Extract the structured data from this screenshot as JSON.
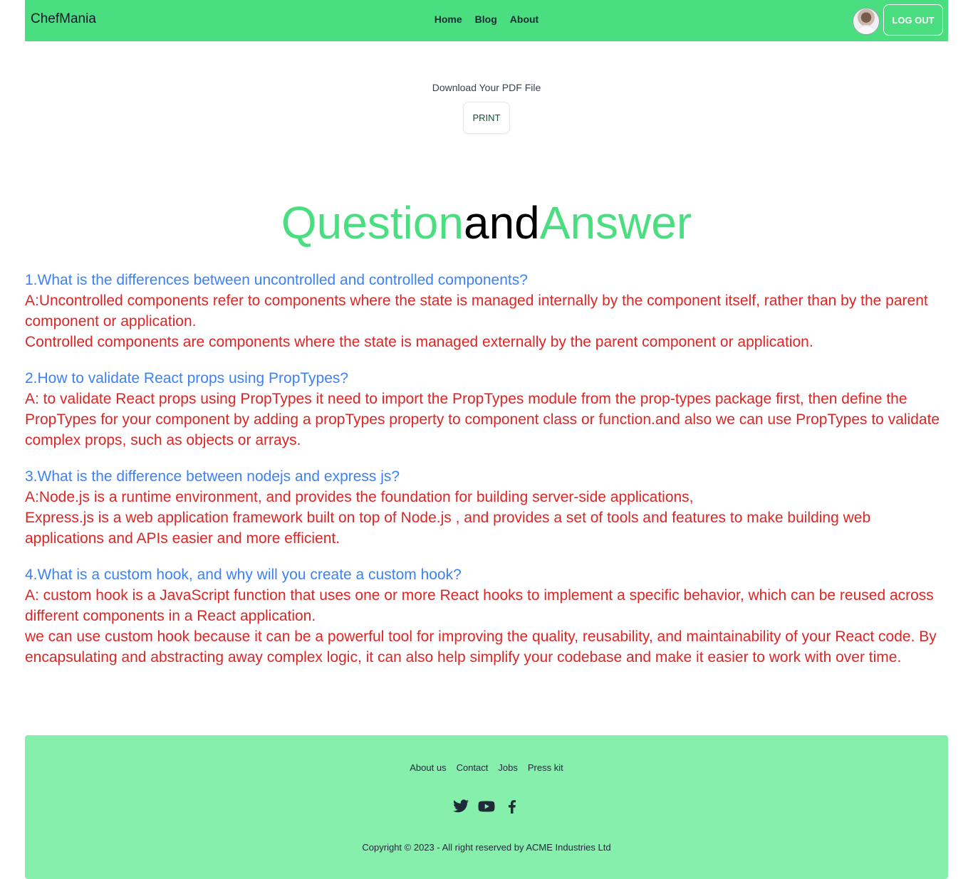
{
  "navbar": {
    "brand": "ChefMania",
    "links": [
      "Home",
      "Blog",
      "About"
    ],
    "logout_label": "LOG OUT",
    "avatar": "user-avatar"
  },
  "download": {
    "label": "Download Your PDF File",
    "print_label": "PRINT"
  },
  "title": {
    "part1": "Question",
    "part2": "and",
    "part3": "Answer"
  },
  "qa": [
    {
      "question": "1.What is the differences between uncontrolled and controlled components?",
      "answer": [
        "A:Uncontrolled components refer to components where the state is managed internally by the component itself, rather than by the parent component or application.",
        "Controlled components are components where the state is managed externally by the parent component or application."
      ]
    },
    {
      "question": "2.How to validate React props using PropTypes?",
      "answer": [
        "A: to validate React props using PropTypes it need to import the PropTypes module from the prop-types package first, then define the PropTypes for your component by adding a propTypes property to component class or function.and also we can use PropTypes to validate complex props, such as objects or arrays."
      ]
    },
    {
      "question": "3.What is the difference between nodejs and express js?",
      "answer": [
        "A:Node.js is a runtime environment, and provides the foundation for building server-side applications,",
        "Express.js is a web application framework built on top of Node.js , and provides a set of tools and features to make building web applications and APIs easier and more efficient."
      ]
    },
    {
      "question": "4.What is a custom hook, and why will you create a custom hook?",
      "answer": [
        "A: custom hook is a JavaScript function that uses one or more React hooks to implement a specific behavior, which can be reused across different components in a React application.",
        "we can use custom hook because it can be a powerful tool for improving the quality, reusability, and maintainability of your React code. By encapsulating and abstracting away complex logic, it can also help simplify your codebase and make it easier to work with over time."
      ]
    }
  ],
  "footer": {
    "links": [
      "About us",
      "Contact",
      "Jobs",
      "Press kit"
    ],
    "social_icons": [
      "twitter-icon",
      "youtube-icon",
      "facebook-icon"
    ],
    "copyright": "Copyright © 2023 - All right reserved by ACME Industries Ltd"
  },
  "colors": {
    "nav_green": "#4ade80",
    "footer_green": "#86efac",
    "question_blue": "#3b82f6",
    "answer_red": "#dc2626"
  }
}
